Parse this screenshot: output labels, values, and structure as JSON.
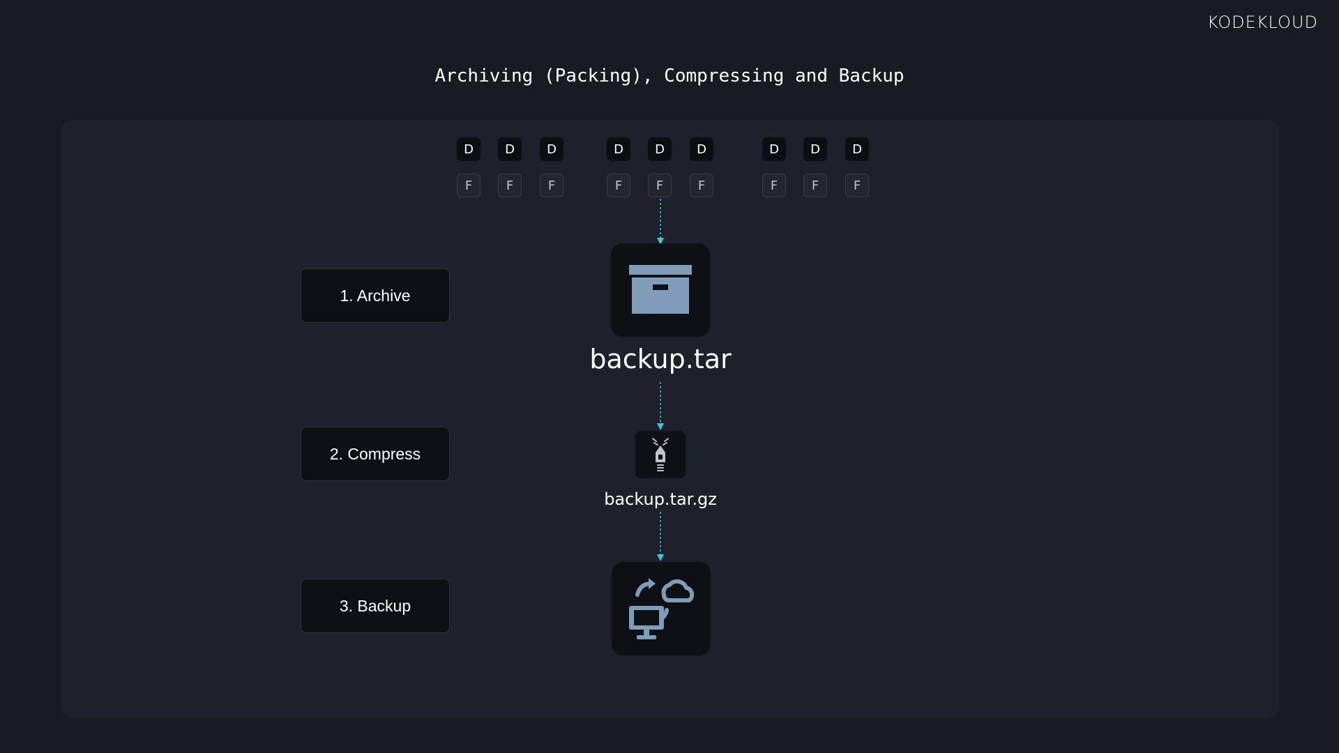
{
  "logo": "KODEKLOUD",
  "title": "Archiving (Packing), Compressing and Backup",
  "dir_label": "D",
  "file_label": "F",
  "steps": [
    {
      "label": "1. Archive"
    },
    {
      "label": "2. Compress"
    },
    {
      "label": "3. Backup"
    }
  ],
  "archive_file": "backup.tar",
  "compressed_file": "backup.tar.gz",
  "icons": {
    "archive": "archive-box-icon",
    "compress": "zipper-icon",
    "backup": "cloud-sync-computer-icon"
  },
  "colors": {
    "arrow": "#3ec6d9",
    "icon": "#7f9db8",
    "background": "#181b22"
  }
}
